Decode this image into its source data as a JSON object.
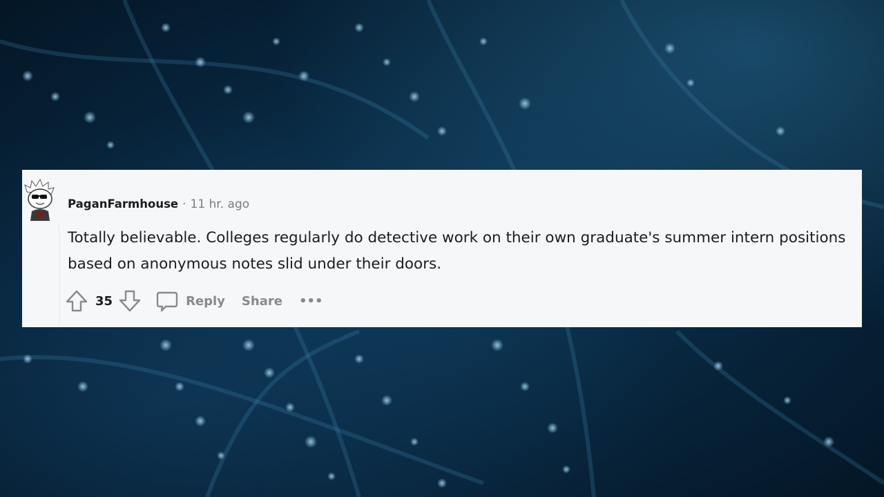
{
  "comment": {
    "username": "PaganFarmhouse",
    "separator": "·",
    "time": "11 hr. ago",
    "body": "Totally believable. Colleges regularly do detective work on their own graduate's summer intern positions based on anonymous notes slid under their doors.",
    "score": "35",
    "actions": {
      "reply_label": "Reply",
      "share_label": "Share",
      "more_label": "•••"
    }
  },
  "icons": {
    "avatar": "snoo-avatar-sunglasses",
    "upvote": "upvote-arrow-icon",
    "downvote": "downvote-arrow-icon",
    "reply": "speech-bubble-icon",
    "more": "ellipsis-icon"
  },
  "colors": {
    "card_background": "#f6f7f8",
    "text_primary": "#1c1c1c",
    "text_muted": "#878a8c",
    "page_background": "#0b2d47"
  }
}
